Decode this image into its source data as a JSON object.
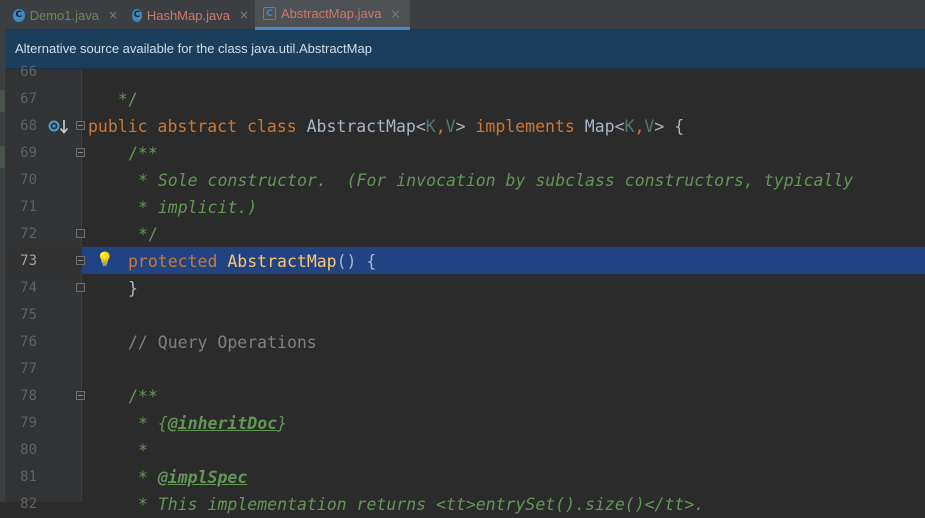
{
  "tabs": [
    {
      "label": "Demo1.java",
      "icon": "class-file-icon",
      "active": false,
      "color": "#6a8759"
    },
    {
      "label": "HashMap.java",
      "icon": "class-file-icon",
      "active": false,
      "color": "#d0766f"
    },
    {
      "label": "AbstractMap.java",
      "icon": "abstract-class-file-icon",
      "active": true,
      "color": "#d0766f"
    }
  ],
  "close_glyph": "×",
  "banner": {
    "text": "Alternative source available for the class java.util.AbstractMap"
  },
  "gutter": {
    "line_numbers": [
      "66",
      "67",
      "68",
      "69",
      "70",
      "71",
      "72",
      "73",
      "74",
      "75",
      "76",
      "77",
      "78",
      "79",
      "80",
      "81",
      "82"
    ],
    "current_line": "73"
  },
  "code": {
    "l66": "*/",
    "l68": {
      "kw1": "public",
      "kw2": "abstract",
      "kw3": "class",
      "name": "AbstractMap",
      "lt": "<",
      "K": "K",
      "comma": ",",
      "V": "V",
      "gt": ">",
      "kw4": "implements",
      "iface": "Map",
      "lt2": "<",
      "K2": "K",
      "comma2": ",",
      "V2": "V",
      "gt2": ">",
      "brace": "{"
    },
    "l69": "/**",
    "l70": "* Sole constructor.  (For invocation by subclass constructors, typically",
    "l71": "* implicit.)",
    "l72": "*/",
    "l73": {
      "kw": "protected",
      "name": "AbstractMap",
      "rest": "() {"
    },
    "l74": "}",
    "l76": "// Query Operations",
    "l78": "/**",
    "l79": {
      "star": "* ",
      "open": "{",
      "tag": "@inheritDoc",
      "close": "}"
    },
    "l80": "*",
    "l81": {
      "star": "* ",
      "tag": "@implSpec"
    },
    "l82": "* This implementation returns <tt>entrySet().size()</tt>."
  },
  "colors": {
    "keyword": "#cc7832",
    "doc_comment": "#629755",
    "line_comment": "#808080",
    "caret_row": "#214283",
    "banner": "#1c3e5d"
  }
}
